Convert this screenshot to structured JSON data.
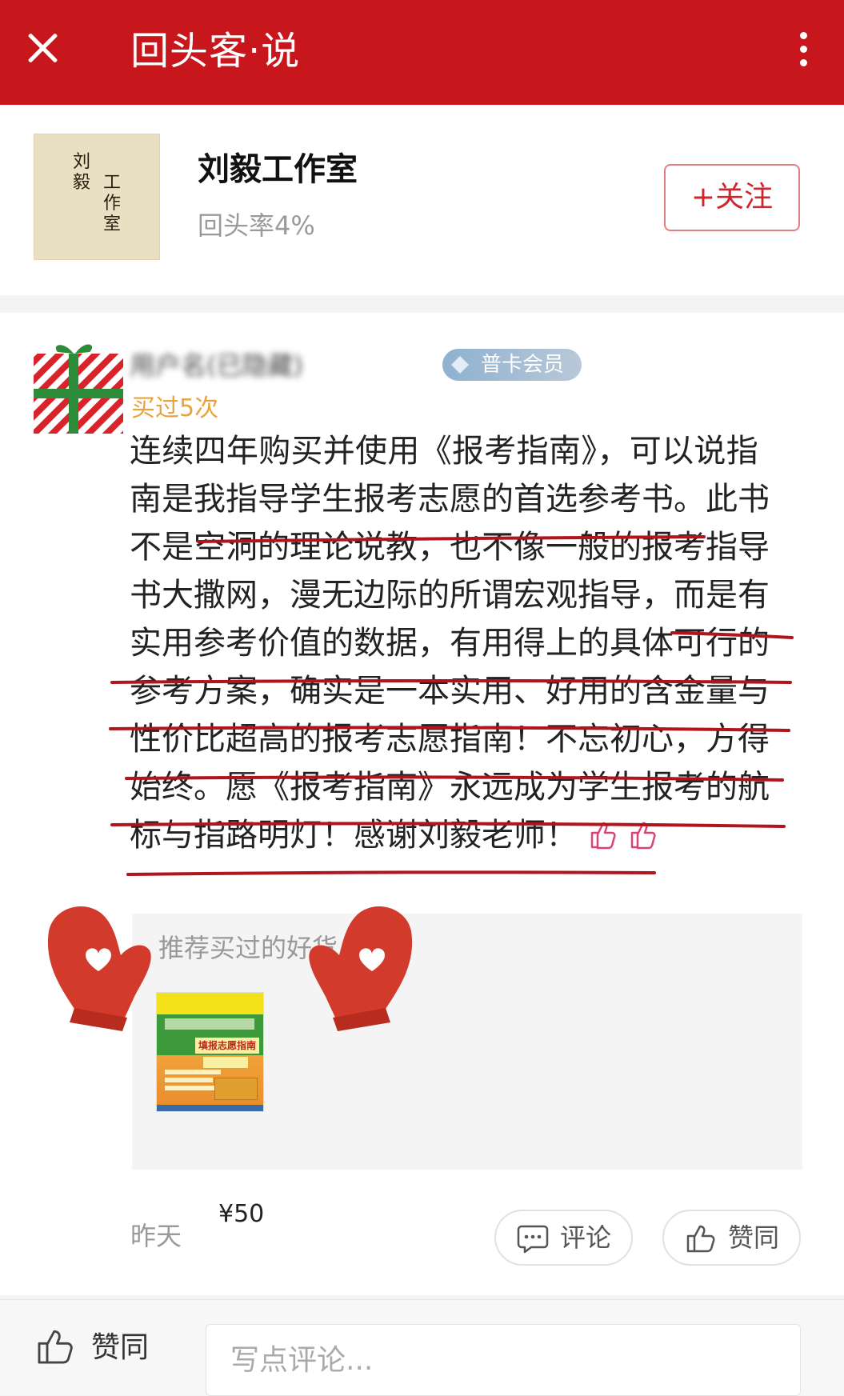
{
  "topbar": {
    "title": "回头客·说",
    "close_icon": "close-icon",
    "menu_icon": "more-vertical-icon"
  },
  "shop": {
    "logo_text_1": "刘毅",
    "logo_text_2": "工作室",
    "name": "刘毅工作室",
    "return_rate": "回头率4%",
    "follow_label": "+关注"
  },
  "review": {
    "username": "用户名(已隐藏)",
    "member_badge": "普卡会员",
    "bought_times": "买过5次",
    "lines": [
      "连续四年购买并使用《报考指南》，可以说指",
      "南是我指导学生报考志愿的首选参考书。此书",
      "不是空洞的理论说教，也不像一般的报考指导",
      "书大撒网，漫无边际的所谓宏观指导，而是有",
      "实用参考价值的数据，有用得上的具体可行的",
      "参考方案，确实是一本实用、好用的含金量与",
      "性价比超高的报考志愿指南！不忘初心，方得",
      "始终。愿《报考指南》永远成为学生报考的航",
      "标与指路明灯！感谢刘毅老师！"
    ],
    "recommend_title": "推荐买过的好货",
    "product_price": "¥50",
    "product_cover_title": "填报志愿指南",
    "date": "昨天",
    "comment_label": "评论",
    "like_label": "赞同"
  },
  "bottombar": {
    "like_label": "赞同",
    "comment_placeholder": "写点评论..."
  },
  "colors": {
    "brand_red": "#c8161d",
    "underline_red": "#b0141c",
    "member_badge_blue": "#8eb1cf",
    "bought_orange": "#e8a33a"
  }
}
